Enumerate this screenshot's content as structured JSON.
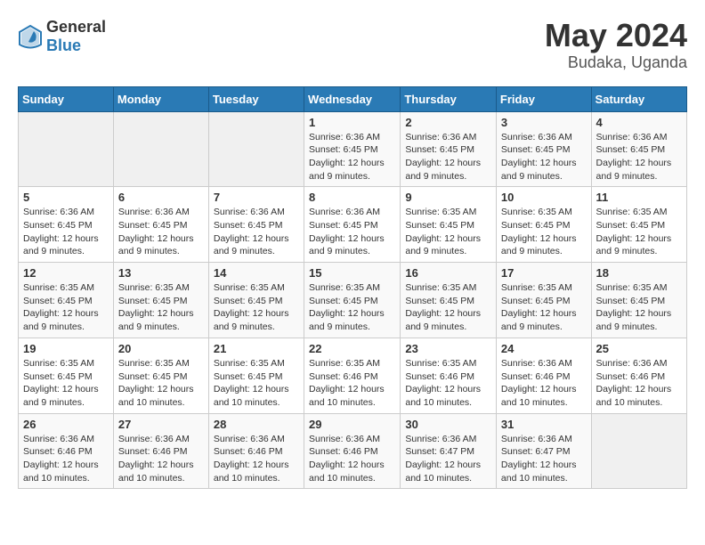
{
  "logo": {
    "general": "General",
    "blue": "Blue"
  },
  "title": {
    "month_year": "May 2024",
    "location": "Budaka, Uganda"
  },
  "days_of_week": [
    "Sunday",
    "Monday",
    "Tuesday",
    "Wednesday",
    "Thursday",
    "Friday",
    "Saturday"
  ],
  "weeks": [
    [
      {
        "day": "",
        "info": ""
      },
      {
        "day": "",
        "info": ""
      },
      {
        "day": "",
        "info": ""
      },
      {
        "day": "1",
        "info": "Sunrise: 6:36 AM\nSunset: 6:45 PM\nDaylight: 12 hours and 9 minutes."
      },
      {
        "day": "2",
        "info": "Sunrise: 6:36 AM\nSunset: 6:45 PM\nDaylight: 12 hours and 9 minutes."
      },
      {
        "day": "3",
        "info": "Sunrise: 6:36 AM\nSunset: 6:45 PM\nDaylight: 12 hours and 9 minutes."
      },
      {
        "day": "4",
        "info": "Sunrise: 6:36 AM\nSunset: 6:45 PM\nDaylight: 12 hours and 9 minutes."
      }
    ],
    [
      {
        "day": "5",
        "info": "Sunrise: 6:36 AM\nSunset: 6:45 PM\nDaylight: 12 hours and 9 minutes."
      },
      {
        "day": "6",
        "info": "Sunrise: 6:36 AM\nSunset: 6:45 PM\nDaylight: 12 hours and 9 minutes."
      },
      {
        "day": "7",
        "info": "Sunrise: 6:36 AM\nSunset: 6:45 PM\nDaylight: 12 hours and 9 minutes."
      },
      {
        "day": "8",
        "info": "Sunrise: 6:36 AM\nSunset: 6:45 PM\nDaylight: 12 hours and 9 minutes."
      },
      {
        "day": "9",
        "info": "Sunrise: 6:35 AM\nSunset: 6:45 PM\nDaylight: 12 hours and 9 minutes."
      },
      {
        "day": "10",
        "info": "Sunrise: 6:35 AM\nSunset: 6:45 PM\nDaylight: 12 hours and 9 minutes."
      },
      {
        "day": "11",
        "info": "Sunrise: 6:35 AM\nSunset: 6:45 PM\nDaylight: 12 hours and 9 minutes."
      }
    ],
    [
      {
        "day": "12",
        "info": "Sunrise: 6:35 AM\nSunset: 6:45 PM\nDaylight: 12 hours and 9 minutes."
      },
      {
        "day": "13",
        "info": "Sunrise: 6:35 AM\nSunset: 6:45 PM\nDaylight: 12 hours and 9 minutes."
      },
      {
        "day": "14",
        "info": "Sunrise: 6:35 AM\nSunset: 6:45 PM\nDaylight: 12 hours and 9 minutes."
      },
      {
        "day": "15",
        "info": "Sunrise: 6:35 AM\nSunset: 6:45 PM\nDaylight: 12 hours and 9 minutes."
      },
      {
        "day": "16",
        "info": "Sunrise: 6:35 AM\nSunset: 6:45 PM\nDaylight: 12 hours and 9 minutes."
      },
      {
        "day": "17",
        "info": "Sunrise: 6:35 AM\nSunset: 6:45 PM\nDaylight: 12 hours and 9 minutes."
      },
      {
        "day": "18",
        "info": "Sunrise: 6:35 AM\nSunset: 6:45 PM\nDaylight: 12 hours and 9 minutes."
      }
    ],
    [
      {
        "day": "19",
        "info": "Sunrise: 6:35 AM\nSunset: 6:45 PM\nDaylight: 12 hours and 9 minutes."
      },
      {
        "day": "20",
        "info": "Sunrise: 6:35 AM\nSunset: 6:45 PM\nDaylight: 12 hours and 10 minutes."
      },
      {
        "day": "21",
        "info": "Sunrise: 6:35 AM\nSunset: 6:45 PM\nDaylight: 12 hours and 10 minutes."
      },
      {
        "day": "22",
        "info": "Sunrise: 6:35 AM\nSunset: 6:46 PM\nDaylight: 12 hours and 10 minutes."
      },
      {
        "day": "23",
        "info": "Sunrise: 6:35 AM\nSunset: 6:46 PM\nDaylight: 12 hours and 10 minutes."
      },
      {
        "day": "24",
        "info": "Sunrise: 6:36 AM\nSunset: 6:46 PM\nDaylight: 12 hours and 10 minutes."
      },
      {
        "day": "25",
        "info": "Sunrise: 6:36 AM\nSunset: 6:46 PM\nDaylight: 12 hours and 10 minutes."
      }
    ],
    [
      {
        "day": "26",
        "info": "Sunrise: 6:36 AM\nSunset: 6:46 PM\nDaylight: 12 hours and 10 minutes."
      },
      {
        "day": "27",
        "info": "Sunrise: 6:36 AM\nSunset: 6:46 PM\nDaylight: 12 hours and 10 minutes."
      },
      {
        "day": "28",
        "info": "Sunrise: 6:36 AM\nSunset: 6:46 PM\nDaylight: 12 hours and 10 minutes."
      },
      {
        "day": "29",
        "info": "Sunrise: 6:36 AM\nSunset: 6:46 PM\nDaylight: 12 hours and 10 minutes."
      },
      {
        "day": "30",
        "info": "Sunrise: 6:36 AM\nSunset: 6:47 PM\nDaylight: 12 hours and 10 minutes."
      },
      {
        "day": "31",
        "info": "Sunrise: 6:36 AM\nSunset: 6:47 PM\nDaylight: 12 hours and 10 minutes."
      },
      {
        "day": "",
        "info": ""
      }
    ]
  ]
}
